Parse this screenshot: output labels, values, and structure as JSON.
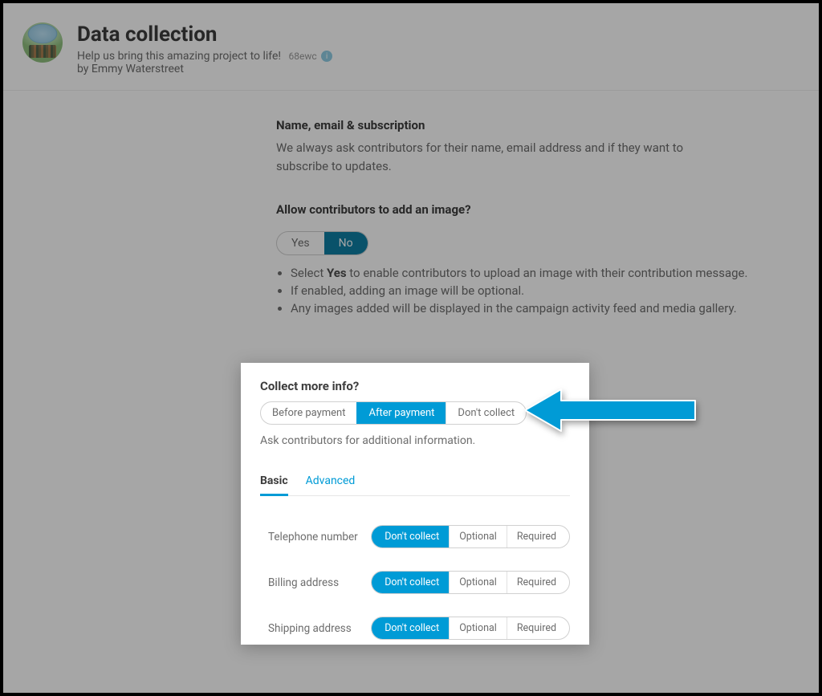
{
  "header": {
    "title": "Data collection",
    "subtitle": "Help us bring this amazing project to life!",
    "code": "68ewc",
    "byline": "by Emmy Waterstreet"
  },
  "section1": {
    "heading": "Name, email & subscription",
    "body": "We always ask contributors for their name, email address and if they want to subscribe to updates."
  },
  "section2": {
    "heading": "Allow contributors to add an image?",
    "options": {
      "yes": "Yes",
      "no": "No"
    },
    "bullets": [
      "Select <b>Yes</b> to enable contributors to upload an image with their contribution message.",
      "If enabled, adding an image will be optional.",
      "Any images added will be displayed in the campaign activity feed and media gallery."
    ]
  },
  "card": {
    "heading": "Collect more info?",
    "segments": {
      "before": "Before payment",
      "after": "After payment",
      "dont": "Don't collect"
    },
    "desc": "Ask contributors for additional information.",
    "tabs": {
      "basic": "Basic",
      "advanced": "Advanced"
    },
    "pill_labels": {
      "dont": "Don't collect",
      "optional": "Optional",
      "required": "Required"
    },
    "fields": {
      "telephone": "Telephone number",
      "billing": "Billing address",
      "shipping": "Shipping address"
    }
  }
}
